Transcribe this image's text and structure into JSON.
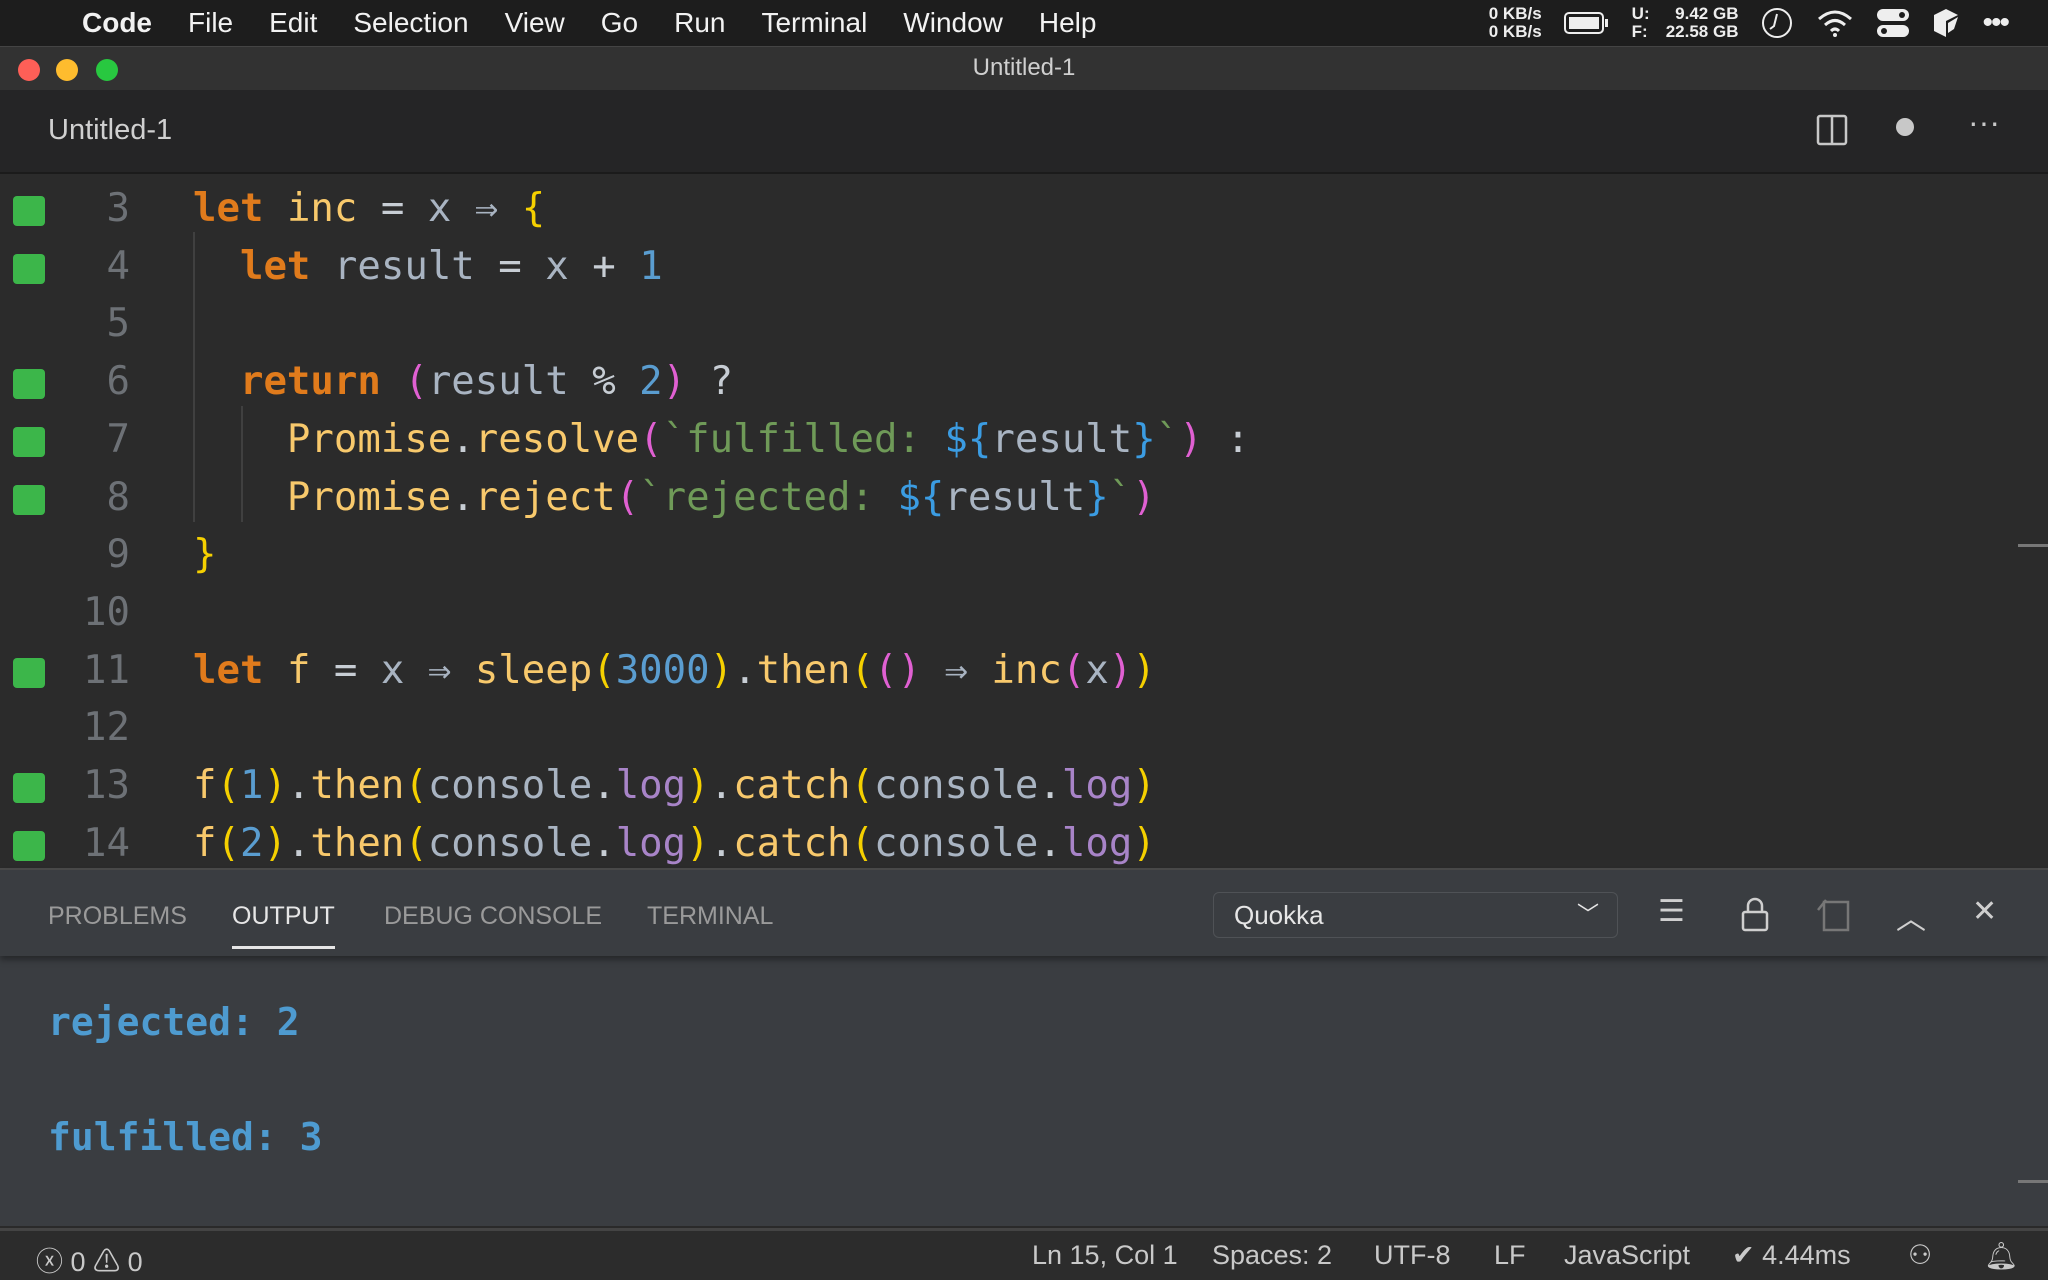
{
  "menubar": {
    "items": [
      "Code",
      "File",
      "Edit",
      "Selection",
      "View",
      "Go",
      "Run",
      "Terminal",
      "Window",
      "Help"
    ],
    "net": [
      "0 KB/s",
      "0 KB/s"
    ],
    "disk": [
      {
        "k": "U:",
        "v": "9.42 GB"
      },
      {
        "k": "F:",
        "v": "22.58 GB"
      }
    ]
  },
  "window": {
    "title": "Untitled-1"
  },
  "tab": {
    "title": "Untitled-1"
  },
  "editor": {
    "lines": [
      {
        "num": "3",
        "marker": true,
        "indent": 0,
        "tokens": [
          [
            "let",
            "kw"
          ],
          [
            " "
          ],
          [
            "inc",
            "fn"
          ],
          [
            " = ",
            "op"
          ],
          [
            "x",
            "id"
          ],
          [
            " ⇒ ",
            "arrow"
          ],
          [
            "{",
            "p1"
          ]
        ]
      },
      {
        "num": "4",
        "marker": true,
        "indent": 2,
        "tokens": [
          [
            "let",
            "kw"
          ],
          [
            " "
          ],
          [
            "result",
            "id"
          ],
          [
            " = ",
            "op"
          ],
          [
            "x",
            "id"
          ],
          [
            " + ",
            "op"
          ],
          [
            "1",
            "num"
          ]
        ]
      },
      {
        "num": "5",
        "marker": false,
        "indent": 0,
        "tokens": []
      },
      {
        "num": "6",
        "marker": true,
        "indent": 2,
        "tokens": [
          [
            "return",
            "kw"
          ],
          [
            " "
          ],
          [
            "(",
            "p2"
          ],
          [
            "result",
            "id"
          ],
          [
            " % ",
            "op"
          ],
          [
            "2",
            "num"
          ],
          [
            ")",
            "p2"
          ],
          [
            " ?",
            "op"
          ]
        ]
      },
      {
        "num": "7",
        "marker": true,
        "indent": 4,
        "tokens": [
          [
            "Promise",
            "fn"
          ],
          [
            ".",
            "op"
          ],
          [
            "resolve",
            "fn"
          ],
          [
            "(",
            "p2"
          ],
          [
            "`fulfilled: ",
            "str"
          ],
          [
            "${",
            "tpl"
          ],
          [
            "result",
            "id"
          ],
          [
            "}",
            "tpl"
          ],
          [
            "`",
            "str"
          ],
          [
            ")",
            "p2"
          ],
          [
            " :",
            "op"
          ]
        ]
      },
      {
        "num": "8",
        "marker": true,
        "indent": 4,
        "tokens": [
          [
            "Promise",
            "fn"
          ],
          [
            ".",
            "op"
          ],
          [
            "reject",
            "fn"
          ],
          [
            "(",
            "p2"
          ],
          [
            "`rejected: ",
            "str"
          ],
          [
            "${",
            "tpl"
          ],
          [
            "result",
            "id"
          ],
          [
            "}",
            "tpl"
          ],
          [
            "`",
            "str"
          ],
          [
            ")",
            "p2"
          ]
        ]
      },
      {
        "num": "9",
        "marker": false,
        "indent": 0,
        "tokens": [
          [
            "}",
            "p1"
          ]
        ]
      },
      {
        "num": "10",
        "marker": false,
        "indent": 0,
        "tokens": []
      },
      {
        "num": "11",
        "marker": true,
        "indent": 0,
        "tokens": [
          [
            "let",
            "kw"
          ],
          [
            " "
          ],
          [
            "f",
            "fn"
          ],
          [
            " = ",
            "op"
          ],
          [
            "x",
            "id"
          ],
          [
            " ⇒ ",
            "arrow"
          ],
          [
            "sleep",
            "fn"
          ],
          [
            "(",
            "p1"
          ],
          [
            "3000",
            "num"
          ],
          [
            ")",
            "p1"
          ],
          [
            ".",
            "op"
          ],
          [
            "then",
            "fn"
          ],
          [
            "(",
            "p1"
          ],
          [
            "()",
            "p2"
          ],
          [
            " ⇒ ",
            "arrow"
          ],
          [
            "inc",
            "fn"
          ],
          [
            "(",
            "p2"
          ],
          [
            "x",
            "id"
          ],
          [
            ")",
            "p2"
          ],
          [
            ")",
            "p1"
          ]
        ]
      },
      {
        "num": "12",
        "marker": false,
        "indent": 0,
        "tokens": []
      },
      {
        "num": "13",
        "marker": true,
        "indent": 0,
        "tokens": [
          [
            "f",
            "fn"
          ],
          [
            "(",
            "p1"
          ],
          [
            "1",
            "num"
          ],
          [
            ")",
            "p1"
          ],
          [
            ".",
            "op"
          ],
          [
            "then",
            "fn"
          ],
          [
            "(",
            "p1"
          ],
          [
            "console",
            "id"
          ],
          [
            ".",
            "op"
          ],
          [
            "log",
            "prop"
          ],
          [
            ")",
            "p1"
          ],
          [
            ".",
            "op"
          ],
          [
            "catch",
            "fn"
          ],
          [
            "(",
            "p1"
          ],
          [
            "console",
            "id"
          ],
          [
            ".",
            "op"
          ],
          [
            "log",
            "prop"
          ],
          [
            ")",
            "p1"
          ]
        ]
      },
      {
        "num": "14",
        "marker": true,
        "indent": 0,
        "tokens": [
          [
            "f",
            "fn"
          ],
          [
            "(",
            "p1"
          ],
          [
            "2",
            "num"
          ],
          [
            ")",
            "p1"
          ],
          [
            ".",
            "op"
          ],
          [
            "then",
            "fn"
          ],
          [
            "(",
            "p1"
          ],
          [
            "console",
            "id"
          ],
          [
            ".",
            "op"
          ],
          [
            "log",
            "prop"
          ],
          [
            ")",
            "p1"
          ],
          [
            ".",
            "op"
          ],
          [
            "catch",
            "fn"
          ],
          [
            "(",
            "p1"
          ],
          [
            "console",
            "id"
          ],
          [
            ".",
            "op"
          ],
          [
            "log",
            "prop"
          ],
          [
            ")",
            "p1"
          ]
        ]
      }
    ]
  },
  "panel": {
    "tabs": [
      "PROBLEMS",
      "OUTPUT",
      "DEBUG CONSOLE",
      "TERMINAL"
    ],
    "active_tab": "OUTPUT",
    "channel": "Quokka",
    "output": [
      "rejected: 2",
      "fulfilled: 3"
    ]
  },
  "statusbar": {
    "errors": "0",
    "warnings": "0",
    "position": "Ln 15, Col 1",
    "spaces": "Spaces: 2",
    "encoding": "UTF-8",
    "eol": "LF",
    "language": "JavaScript",
    "quokka": "✔ 4.44ms"
  },
  "colors": {
    "marker": "#3cb64a",
    "keyword": "#e07b1c",
    "function": "#f8c96c",
    "string": "#6f9a58",
    "number": "#5a9dd0",
    "output": "#4e9bd0"
  }
}
